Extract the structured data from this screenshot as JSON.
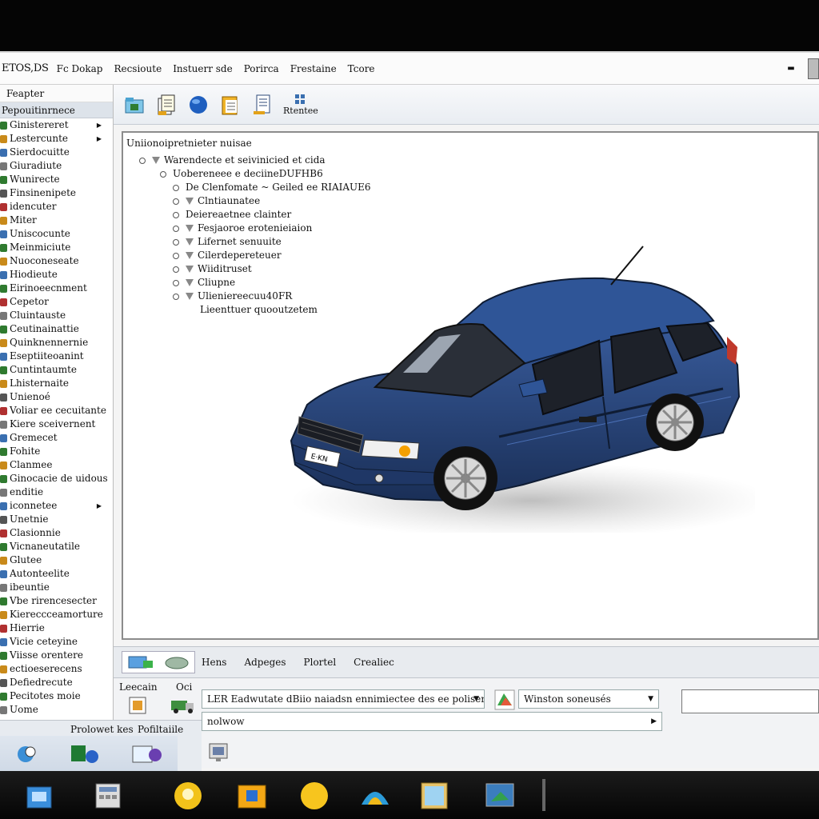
{
  "window": {
    "app_title": "ETOS,DS",
    "menu": [
      "Fc Dokap",
      "Recsioute",
      "Instuerr sde",
      "Porirca",
      "Frestaine",
      "Tcore"
    ],
    "minimize_glyph": "▬"
  },
  "sidebar": {
    "header": "Feapter",
    "subheader": "Pepouitinrnece",
    "items": [
      {
        "label": "Ginistereret",
        "icon_color": "#2f7a2f",
        "submenu": true
      },
      {
        "label": "Lestercunte",
        "icon_color": "#c98a1a",
        "submenu": true
      },
      {
        "label": "Sierdocuitte",
        "icon_color": "#3a6fb0"
      },
      {
        "label": "Giuradiute",
        "icon_color": "#777"
      },
      {
        "label": "Wunirecte",
        "icon_color": "#2f7a2f"
      },
      {
        "label": "Finsinenipete",
        "icon_color": "#555"
      },
      {
        "label": "idencuter",
        "icon_color": "#b03030"
      },
      {
        "label": "Miter",
        "icon_color": "#c98a1a"
      },
      {
        "label": "Uniscocunte",
        "icon_color": "#3a6fb0"
      },
      {
        "label": "Meinmiciute",
        "icon_color": "#2f7a2f"
      },
      {
        "label": "Nuoconeseate",
        "icon_color": "#c98a1a"
      },
      {
        "label": "Hiodieute",
        "icon_color": "#3a6fb0"
      },
      {
        "label": "Eirinoeecnment",
        "icon_color": "#2f7a2f"
      },
      {
        "label": "Cepetor",
        "icon_color": "#b03030"
      },
      {
        "label": "Cluintauste",
        "icon_color": "#777"
      },
      {
        "label": "Ceutinainattie",
        "icon_color": "#2f7a2f"
      },
      {
        "label": "Quinknennernie",
        "icon_color": "#c98a1a"
      },
      {
        "label": "Eseptiiteoanint",
        "icon_color": "#3a6fb0"
      },
      {
        "label": "Cuntintaumte",
        "icon_color": "#2f7a2f"
      },
      {
        "label": "Lhisternaite",
        "icon_color": "#c98a1a"
      },
      {
        "label": "Unienoé",
        "icon_color": "#555"
      },
      {
        "label": "Voliar ee cecuitante",
        "icon_color": "#b03030"
      },
      {
        "label": "Kiere sceivernent",
        "icon_color": "#777"
      },
      {
        "label": "Gremecet",
        "icon_color": "#3a6fb0"
      },
      {
        "label": "Fohite",
        "icon_color": "#2f7a2f"
      },
      {
        "label": "Clanmee",
        "icon_color": "#c98a1a"
      },
      {
        "label": "Ginocacie de uidous",
        "icon_color": "#2f7a2f"
      },
      {
        "label": "enditie",
        "icon_color": "#777"
      },
      {
        "label": "iconnetee",
        "icon_color": "#3a6fb0",
        "submenu": true
      },
      {
        "label": "Unetnie",
        "icon_color": "#555"
      },
      {
        "label": "Clasionnie",
        "icon_color": "#b03030"
      },
      {
        "label": "Vicnaneutatile",
        "icon_color": "#2f7a2f"
      },
      {
        "label": "Glutee",
        "icon_color": "#c98a1a"
      },
      {
        "label": "Autonteelite",
        "icon_color": "#3a6fb0"
      },
      {
        "label": "ibeuntie",
        "icon_color": "#777"
      },
      {
        "label": "Vbe rirencesecter",
        "icon_color": "#2f7a2f"
      },
      {
        "label": "Kiereccceamorture",
        "icon_color": "#c98a1a"
      },
      {
        "label": "Hierrie",
        "icon_color": "#b03030"
      },
      {
        "label": "Vicie ceteyine",
        "icon_color": "#3a6fb0"
      },
      {
        "label": "Viisse orentere",
        "icon_color": "#2f7a2f"
      },
      {
        "label": "ectioeserecens",
        "icon_color": "#c98a1a"
      },
      {
        "label": "Defiedrecute",
        "icon_color": "#555"
      },
      {
        "label": "Pecitotes moie",
        "icon_color": "#2f7a2f"
      },
      {
        "label": "Uome",
        "icon_color": "#777"
      }
    ]
  },
  "toolbar": {
    "buttons": [
      {
        "icon": "open-folder-icon",
        "color": "#2e7d32"
      },
      {
        "icon": "document-icon",
        "color": "#e3a21a"
      },
      {
        "icon": "globe-icon",
        "color": "#1f5fbf"
      },
      {
        "icon": "clipboard-icon",
        "color": "#e3a21a"
      },
      {
        "icon": "report-icon",
        "color": "#e3a21a"
      }
    ],
    "last_button_label": "Rtentee"
  },
  "tree": {
    "title": "Uniionoipretnieter nuisae",
    "rows": [
      {
        "label": "Warendecte et seivinicied et cida",
        "level": 0,
        "node_icon": true
      },
      {
        "label": "Uobereneee e deciineDUFHB6",
        "level": 1,
        "node_icon": false
      },
      {
        "label": "De Clenfomate ~ Geiled ee RIAIAUE6",
        "level": 2,
        "node_icon": false
      },
      {
        "label": "Clntiaunatee",
        "level": 2,
        "node_icon": true
      },
      {
        "label": "Deiereaetnee clainter",
        "level": 2,
        "node_icon": false
      },
      {
        "label": "Fesjaoroe erotenieiaion",
        "level": 2,
        "node_icon": true
      },
      {
        "label": "Lifernet senuuite",
        "level": 2,
        "node_icon": true
      },
      {
        "label": "Cilerdepereteuer",
        "level": 2,
        "node_icon": true
      },
      {
        "label": "Wiiditruset",
        "level": 2,
        "node_icon": true
      },
      {
        "label": "Cliupne",
        "level": 2,
        "node_icon": true
      },
      {
        "label": "Ulieniereecuu40FR",
        "level": 2,
        "node_icon": true
      },
      {
        "label": "Lieenttuer quooutzetem",
        "level": 3,
        "node_icon": false
      }
    ]
  },
  "car": {
    "body_color": "#27457a",
    "plate_text": "E·KN"
  },
  "bottom_tabs": {
    "tabs": [
      "Hens",
      "Adpeges",
      "Plortel",
      "Crealiec"
    ]
  },
  "properties": {
    "label_left": "Leecain",
    "label_right": "Oci",
    "field_main": "LER Eadwutate dBiio naiadsn ennimiectee des ee poliserttles",
    "field_secondary": "Winston soneusés",
    "field_second_row": "nolwow",
    "label_bottom_left": "Prolowet kes",
    "label_bottom_right": "Pofiltaiile"
  },
  "taskbar": {
    "items": [
      "network-icon",
      "calculator-icon",
      "lightbulb-icon",
      "folder-icon",
      "sun-icon",
      "browser-icon",
      "window-icon",
      "screen-icon"
    ]
  }
}
